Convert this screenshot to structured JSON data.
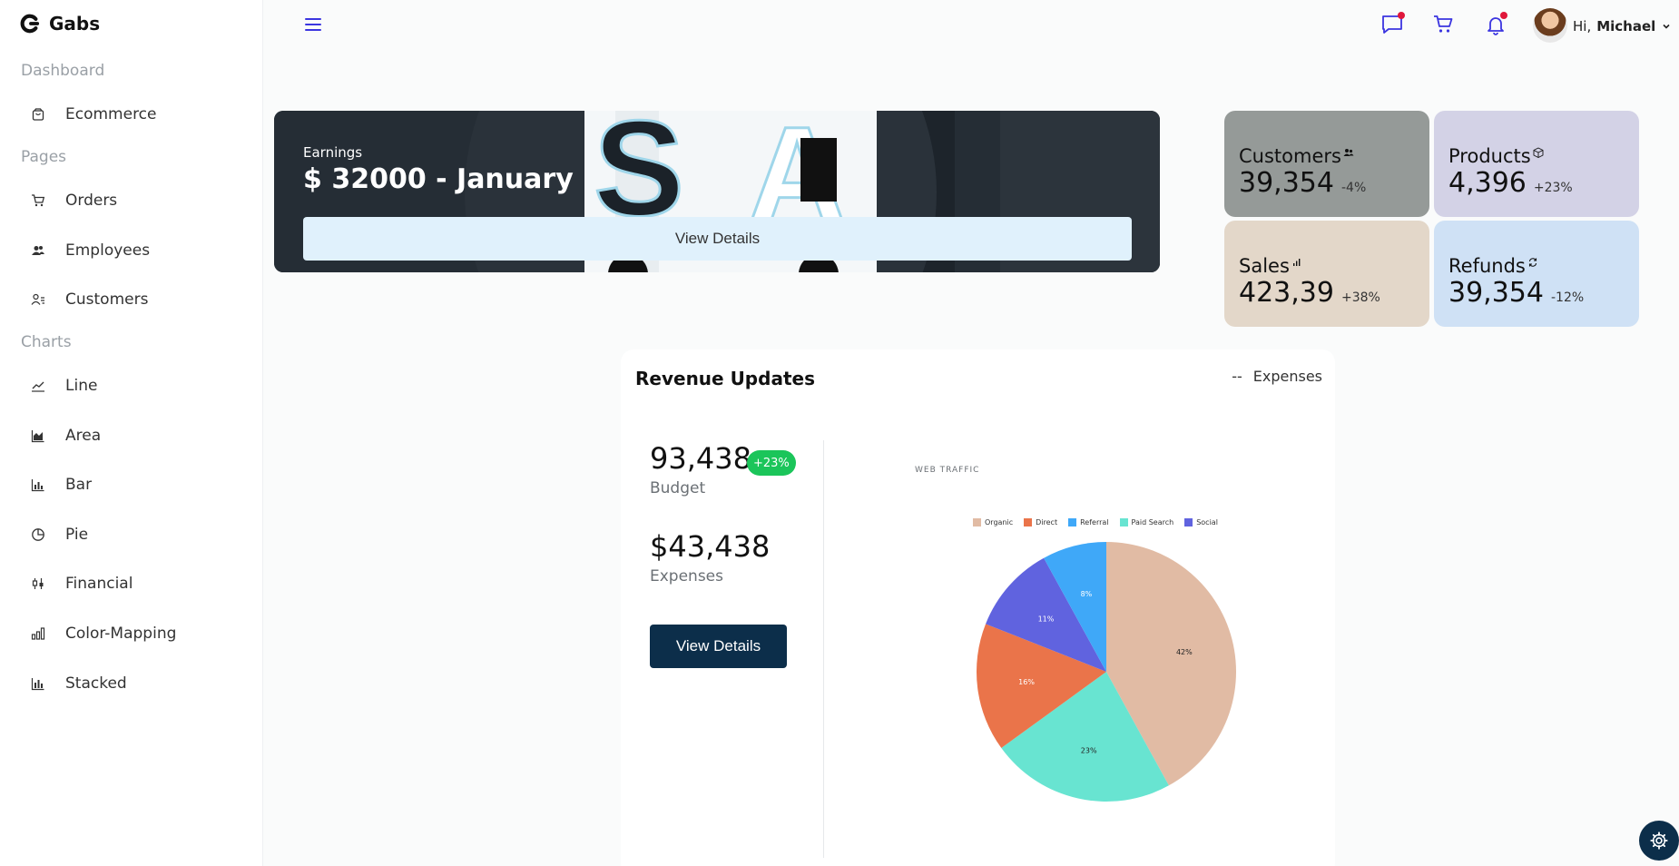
{
  "brand": {
    "name": "Gabs"
  },
  "sidebar": {
    "sections": [
      {
        "label": "Dashboard",
        "items": [
          {
            "label": "Ecommerce",
            "icon": "bag-icon"
          }
        ]
      },
      {
        "label": "Pages",
        "items": [
          {
            "label": "Orders",
            "icon": "cart-icon"
          },
          {
            "label": "Employees",
            "icon": "people-icon"
          },
          {
            "label": "Customers",
            "icon": "user-list-icon"
          }
        ]
      },
      {
        "label": "Charts",
        "items": [
          {
            "label": "Line",
            "icon": "line-chart-icon"
          },
          {
            "label": "Area",
            "icon": "area-chart-icon"
          },
          {
            "label": "Bar",
            "icon": "bar-chart-icon"
          },
          {
            "label": "Pie",
            "icon": "pie-chart-icon"
          },
          {
            "label": "Financial",
            "icon": "candlestick-icon"
          },
          {
            "label": "Color-Mapping",
            "icon": "column-chart-icon"
          },
          {
            "label": "Stacked",
            "icon": "stacked-chart-icon"
          }
        ]
      }
    ]
  },
  "topbar": {
    "greeting_prefix": "Hi,",
    "user_name": "Michael",
    "icons": [
      "chat-icon",
      "cart-icon",
      "bell-icon"
    ],
    "accent": "#3b35e0",
    "notification_dot": "#e0173b"
  },
  "earnings": {
    "label": "Earnings",
    "value": "$ 32000 - January",
    "button": "View Details"
  },
  "tiles": [
    {
      "title": "Customers",
      "value": "39,354",
      "change": "-4%",
      "bg": "#959a98",
      "icon": "group-icon"
    },
    {
      "title": "Products",
      "value": "4,396",
      "change": "+23%",
      "bg": "#d3d2e6",
      "icon": "box-icon"
    },
    {
      "title": "Sales",
      "value": "423,39",
      "change": "+38%",
      "bg": "#e3d7c9",
      "icon": "signal-icon"
    },
    {
      "title": "Refunds",
      "value": "39,354",
      "change": "-12%",
      "bg": "#cfe1f5",
      "icon": "refresh-icon"
    }
  ],
  "revenue": {
    "title": "Revenue Updates",
    "legend_marker": "--",
    "legend_label": "Expenses",
    "budget_value": "93,438",
    "budget_badge": "+23%",
    "budget_label": "Budget",
    "expenses_value": "$43,438",
    "expenses_label": "Expenses",
    "button": "View Details"
  },
  "chart_data": {
    "type": "pie",
    "title": "WEB TRAFFIC",
    "categories": [
      "Organic",
      "Direct",
      "Referral",
      "Paid Search",
      "Social"
    ],
    "values": [
      42,
      16,
      8,
      23,
      11
    ],
    "slices": [
      {
        "label": "Organic",
        "value": 42,
        "text": "42%",
        "color": "#e1bba4"
      },
      {
        "label": "Paid Search",
        "value": 23,
        "text": "23%",
        "color": "#68e4d1"
      },
      {
        "label": "Direct",
        "value": 16,
        "text": "16%",
        "color": "#ea744a"
      },
      {
        "label": "Social",
        "value": 11,
        "text": "11%",
        "color": "#6063df"
      },
      {
        "label": "Referral",
        "value": 8,
        "text": "8%",
        "color": "#3fa8f8"
      }
    ],
    "legend_order": [
      "Organic",
      "Direct",
      "Referral",
      "Paid Search",
      "Social"
    ],
    "legend_placement": "top"
  }
}
